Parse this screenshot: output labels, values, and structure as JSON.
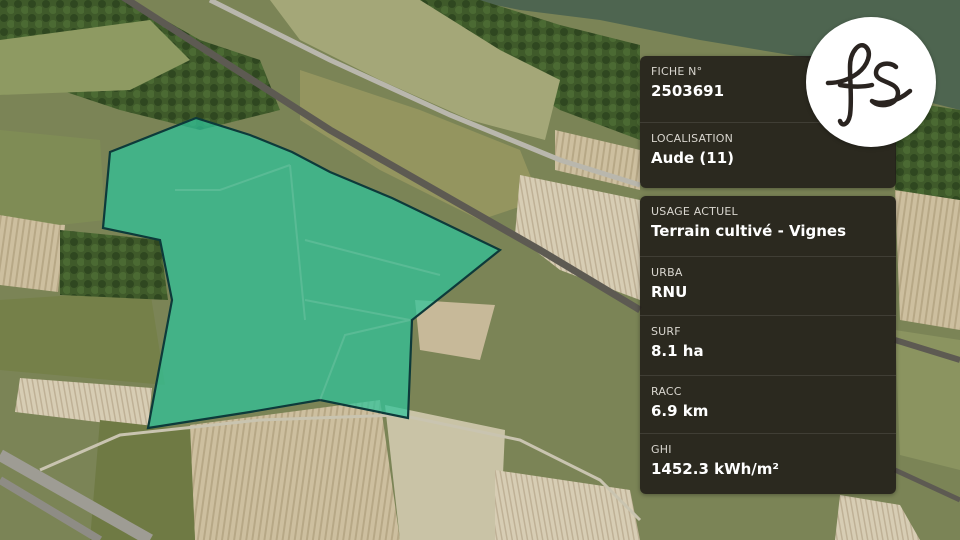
{
  "colors": {
    "parcel_fill": "#2ec49a",
    "parcel_stroke": "#0d3a3a",
    "card_bg": "#1e1a16",
    "logo_ink": "#2a2420"
  },
  "map": {
    "type": "satellite-aerial",
    "parcel_highlighted": true
  },
  "logo": {
    "icon": "fs-monogram-icon",
    "text": "fs"
  },
  "info_top": [
    {
      "label": "FICHE N°",
      "value": "2503691"
    },
    {
      "label": "LOCALISATION",
      "value": "Aude (11)"
    }
  ],
  "info_bottom": [
    {
      "label": "USAGE ACTUEL",
      "value": "Terrain cultivé - Vignes"
    },
    {
      "label": "URBA",
      "value": "RNU"
    },
    {
      "label": "SURF",
      "value": "8.1 ha"
    },
    {
      "label": "RACC",
      "value": "6.9 km"
    },
    {
      "label": "GHI",
      "value": "1452.3 kWh/m²"
    }
  ]
}
